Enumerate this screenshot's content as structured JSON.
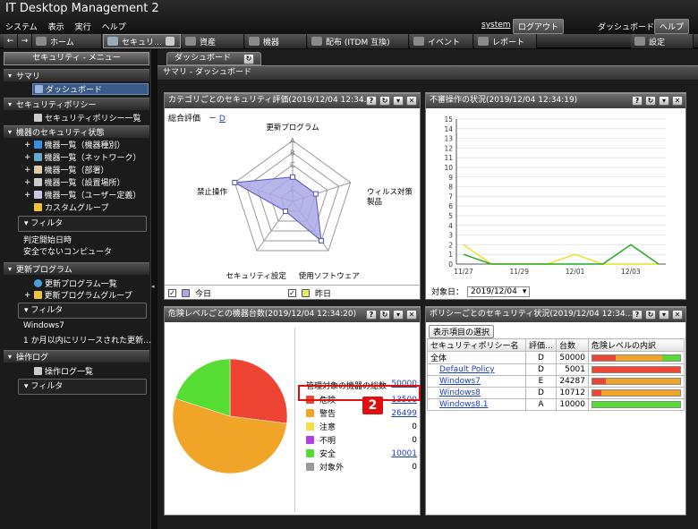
{
  "app": {
    "title": "IT Desktop Management 2",
    "menu": [
      "システム",
      "表示",
      "実行",
      "ヘルプ"
    ],
    "user": "system",
    "logout": "ログアウト",
    "dashboard_label": "ダッシュボード",
    "help": "ヘルプ"
  },
  "tabs": [
    "ホーム",
    "セキュリ…",
    "資産",
    "機器",
    "配布 (ITDM 互換)",
    "イベント",
    "レポート",
    "設定"
  ],
  "left": {
    "header": "セキュリティ - メニュー",
    "summary": "サマリ",
    "dashboard": "ダッシュボード",
    "policy": "セキュリティポリシー",
    "policy_list": "セキュリティポリシー一覧",
    "device_state": "機器のセキュリティ状態",
    "device_items": [
      "機器一覧（機器種別）",
      "機器一覧（ネットワーク）",
      "機器一覧（部署）",
      "機器一覧（設置場所）",
      "機器一覧（ユーザー定義）"
    ],
    "custom_group": "カスタムグループ",
    "filter": "フィルタ",
    "filter1_lines": [
      "判定開始日時",
      "安全でないコンピュータ"
    ],
    "update": "更新プログラム",
    "update_list": "更新プログラム一覧",
    "update_group": "更新プログラムグループ",
    "filter2_lines": [
      "Windows7",
      "1 か月以内にリリースされた更新…"
    ],
    "oplog": "操作ログ",
    "oplog_list": "操作ログ一覧"
  },
  "main": {
    "tab": "ダッシュボード",
    "subtitle": "サマリ - ダッシュボード"
  },
  "radar": {
    "title": "カテゴリごとのセキュリティ評価(2019/12/04 12:34…",
    "overall_label": "総合評価　－",
    "overall_value": "D",
    "axes": [
      "更新プログラム",
      "ウィルス対策製品",
      "使用ソフトウェア",
      "セキュリティ設定",
      "禁止操作"
    ],
    "grades": [
      "A",
      "B",
      "C",
      "D",
      "E"
    ],
    "today_values": [
      2,
      2,
      4,
      1,
      5
    ],
    "yesterday_values": [
      2,
      2,
      4,
      1,
      5
    ],
    "legend_today": "今日",
    "legend_yesterday": "昨日",
    "today_color": "#a9a9e6",
    "yesterday_color": "#e9e96a"
  },
  "line": {
    "title": "不審操作の状況(2019/12/04 12:34:19)",
    "x_labels": [
      "11/27",
      "11/29",
      "12/01",
      "12/03"
    ],
    "y_ticks": [
      0,
      1,
      2,
      3,
      4,
      5,
      6,
      7,
      8,
      9,
      10,
      11,
      12,
      13,
      14,
      15
    ],
    "y_max": 15,
    "series_green": [
      1,
      0,
      0,
      0,
      0,
      0,
      2,
      0
    ],
    "series_yellow": [
      2,
      0,
      0,
      0,
      1,
      0,
      0,
      0
    ],
    "date_label": "対象日：",
    "date_value": "2019/12/04"
  },
  "pie": {
    "title": "危険レベルごとの機器台数(2019/12/04 12:34:20)",
    "total_label": "管理対象の機器の総数",
    "total_value": "50000",
    "items": [
      {
        "label": "危険",
        "value": "13500",
        "color": "#ee4433",
        "link": true
      },
      {
        "label": "警告",
        "value": "26499",
        "color": "#f0a428",
        "link": true
      },
      {
        "label": "注意",
        "value": "0",
        "color": "#f0e040",
        "link": false
      },
      {
        "label": "不明",
        "value": "0",
        "color": "#b040e0",
        "link": false
      },
      {
        "label": "安全",
        "value": "10001",
        "color": "#55dd33",
        "link": true
      },
      {
        "label": "対象外",
        "value": "0",
        "color": "#999999",
        "link": false
      }
    ],
    "callout": "2"
  },
  "policy": {
    "title": "ポリシーごとのセキュリティ状況(2019/12/04 12:34…",
    "select_button": "表示項目の選択",
    "headers": [
      "セキュリティポリシー名",
      "評価…",
      "台数",
      "危険レベルの内訳"
    ],
    "rows": [
      {
        "name": "全体",
        "grade": "D",
        "count": "50000",
        "link": false,
        "split": [
          0.27,
          0.53,
          0.2
        ]
      },
      {
        "name": "Default Policy",
        "grade": "D",
        "count": "5001",
        "link": true,
        "split": [
          1,
          0,
          0
        ]
      },
      {
        "name": "Windows7",
        "grade": "E",
        "count": "24287",
        "link": true,
        "split": [
          0.15,
          0.85,
          0
        ]
      },
      {
        "name": "Windows8",
        "grade": "D",
        "count": "10712",
        "link": true,
        "split": [
          0.1,
          0.9,
          0
        ]
      },
      {
        "name": "Windows8.1",
        "grade": "A",
        "count": "10000",
        "link": true,
        "split": [
          0,
          0,
          1
        ]
      }
    ]
  }
}
